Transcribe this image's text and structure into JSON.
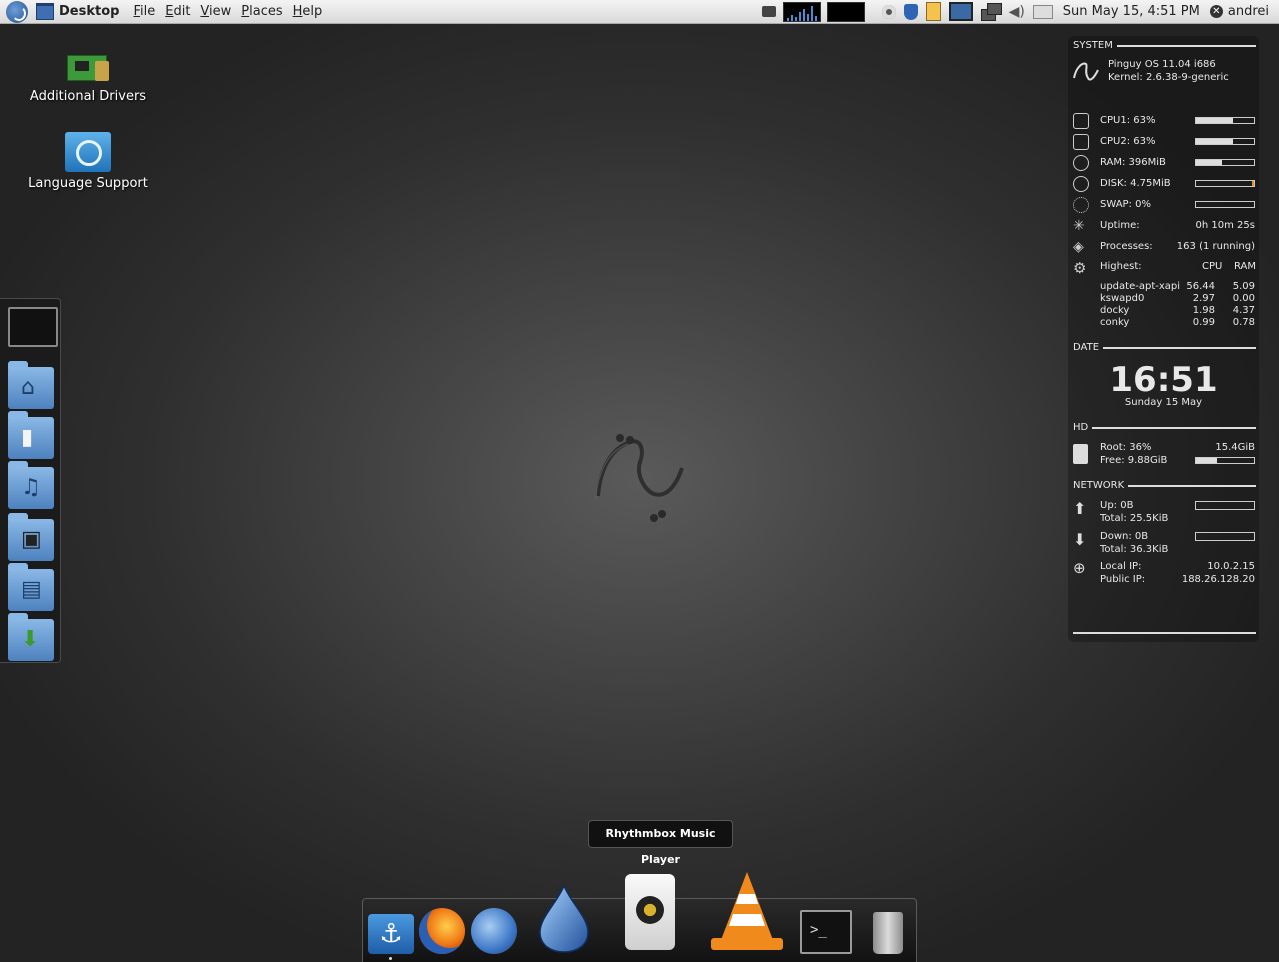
{
  "top_panel": {
    "app_name": "Desktop",
    "menus": [
      {
        "first": "F",
        "rest": "ile"
      },
      {
        "first": "E",
        "rest": "dit"
      },
      {
        "first": "V",
        "rest": "iew"
      },
      {
        "first": "P",
        "rest": "laces"
      },
      {
        "first": "H",
        "rest": "elp"
      }
    ],
    "clock": "Sun May 15, 4:51 PM",
    "user": "andrei"
  },
  "desktop_icons": [
    {
      "label": "Additional Drivers"
    },
    {
      "label": "Language Support"
    }
  ],
  "conky": {
    "system": {
      "header": "SYSTEM",
      "os": "Pinguy OS 11.04 i686",
      "kernel": "Kernel: 2.6.38-9-generic",
      "cpu1": {
        "label": "CPU1: 63%",
        "level": 0.63
      },
      "cpu2": {
        "label": "CPU2: 63%",
        "level": 0.63
      },
      "ram": {
        "label": "RAM: 396MiB",
        "level": 0.45
      },
      "disk": {
        "label": "DISK: 4.75MiB",
        "level": 0.04
      },
      "swap": {
        "label": "SWAP: 0%",
        "level": 0
      },
      "uptime_label": "Uptime:",
      "uptime_value": "0h 10m 25s",
      "processes_label": "Processes:",
      "processes_value": "163 (1 running)",
      "highest_label": "Highest:",
      "col_cpu": "CPU",
      "col_ram": "RAM",
      "top": [
        {
          "name": "update-apt-xapi",
          "cpu": "56.44",
          "ram": "5.09"
        },
        {
          "name": "kswapd0",
          "cpu": "2.97",
          "ram": "0.00"
        },
        {
          "name": "docky",
          "cpu": "1.98",
          "ram": "4.37"
        },
        {
          "name": "conky",
          "cpu": "0.99",
          "ram": "0.78"
        }
      ]
    },
    "date": {
      "header": "DATE",
      "time": "16:51",
      "day": "Sunday 15 May"
    },
    "hd": {
      "header": "HD",
      "root": "Root: 36%",
      "size": "15.4GiB",
      "free": "Free: 9.88GiB",
      "level": 0.36
    },
    "network": {
      "header": "NETWORK",
      "up": "Up: 0B",
      "up_total": "Total: 25.5KiB",
      "down": "Down: 0B",
      "down_total": "Total: 36.3KiB",
      "local_ip_label": "Local IP:",
      "local_ip": "10.0.2.15",
      "public_ip_label": "Public IP:",
      "public_ip": "188.26.128.20"
    }
  },
  "tooltip": "Rhythmbox Music Player",
  "dock": [
    {
      "icon": "anchor-icon"
    },
    {
      "icon": "firefox-icon"
    },
    {
      "icon": "thunderbird-icon"
    },
    {
      "icon": "deluge-icon"
    },
    {
      "icon": "rhythmbox-icon"
    },
    {
      "icon": "vlc-icon"
    },
    {
      "icon": "terminal-icon"
    },
    {
      "icon": "trash-icon"
    }
  ],
  "terminal_prompt": ">_",
  "colors": {
    "accent": "#4a8ad8",
    "vlc_orange": "#f08a1c"
  }
}
